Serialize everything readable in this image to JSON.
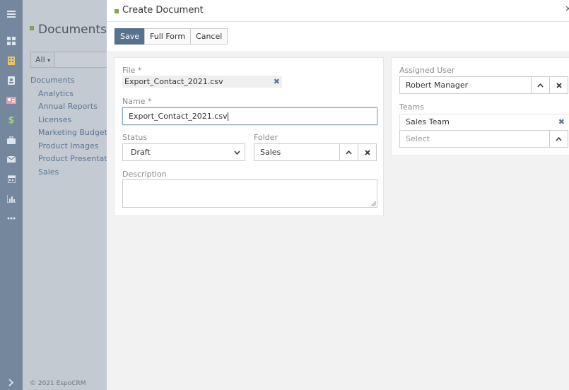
{
  "rail": {
    "icons": [
      "menu-icon",
      "dashboard-icon",
      "building-icon",
      "contact-book-icon",
      "id-card-icon",
      "dollar-icon",
      "briefcase-icon",
      "envelope-icon",
      "calendar-icon",
      "chart-icon",
      "more-icon",
      "expand-icon"
    ]
  },
  "background": {
    "page_title": "Documents",
    "filter_label": "All",
    "folders": [
      "Documents",
      "Analytics",
      "Annual Reports",
      "Licenses",
      "Marketing Budget",
      "Product Images",
      "Product Presentations",
      "Sales"
    ],
    "footer": "© 2021 EspoCRM"
  },
  "modal": {
    "title": "Create Document",
    "close_glyph": "×",
    "buttons": {
      "save": "Save",
      "full_form": "Full Form",
      "cancel": "Cancel"
    },
    "file": {
      "label": "File *",
      "value": "Export_Contact_2021.csv"
    },
    "name": {
      "label": "Name *",
      "value": "Export_Contact_2021.csv"
    },
    "status": {
      "label": "Status",
      "value": "Draft"
    },
    "folder": {
      "label": "Folder",
      "value": "Sales"
    },
    "description": {
      "label": "Description",
      "value": ""
    },
    "assigned_user": {
      "label": "Assigned User",
      "value": "Robert Manager"
    },
    "teams": {
      "label": "Teams",
      "items": [
        "Sales Team"
      ],
      "placeholder": "Select"
    }
  },
  "colors": {
    "primary": "#58718e",
    "rail": "#75879c",
    "accent": "#7ea54d",
    "link": "#5b7897"
  }
}
